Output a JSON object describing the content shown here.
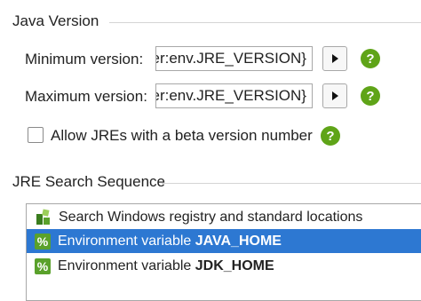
{
  "java_version": {
    "title": "Java Version",
    "min_label": "Minimum version:",
    "min_value": "er:env.JRE_VERSION}",
    "max_label": "Maximum version:",
    "max_value": "er:env.JRE_VERSION}",
    "help_glyph": "?",
    "beta_checkbox_label": "Allow JREs with a beta version number",
    "beta_checked": false
  },
  "jre_search": {
    "title": "JRE Search Sequence",
    "items": [
      {
        "text": "Search Windows registry and standard locations",
        "bold": "",
        "icon": "registry-icon",
        "selected": false
      },
      {
        "text": "Environment variable ",
        "bold": "JAVA_HOME",
        "icon": "percent-icon",
        "selected": true
      },
      {
        "text": "Environment variable ",
        "bold": "JDK_HOME",
        "icon": "percent-icon",
        "selected": false
      }
    ],
    "percent_glyph": "%"
  },
  "colors": {
    "selection": "#2d78d2",
    "help": "#5fa418",
    "percent_icon": "#5aa12b"
  }
}
